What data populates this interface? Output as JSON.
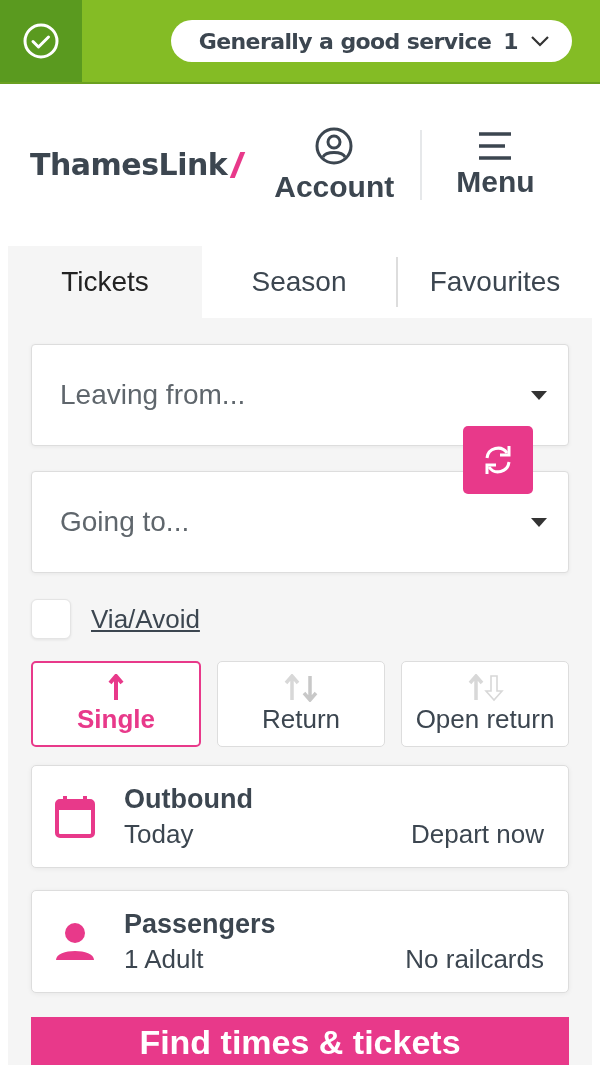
{
  "status_bar": {
    "message": "Generally a good service",
    "count": "1"
  },
  "header": {
    "logo": "ThamesLink",
    "account": "Account",
    "menu": "Menu"
  },
  "tabs": [
    {
      "label": "Tickets",
      "selected": true
    },
    {
      "label": "Season",
      "selected": false
    },
    {
      "label": "Favourites",
      "selected": false
    }
  ],
  "from_field": {
    "placeholder": "Leaving from..."
  },
  "to_field": {
    "placeholder": "Going to..."
  },
  "via": {
    "label": "Via/Avoid",
    "checked": false
  },
  "ticket_types": [
    {
      "label": "Single",
      "kind": "single",
      "selected": true
    },
    {
      "label": "Return",
      "kind": "return",
      "selected": false
    },
    {
      "label": "Open return",
      "kind": "open",
      "selected": false
    }
  ],
  "outbound": {
    "title": "Outbound",
    "date": "Today",
    "time": "Depart now"
  },
  "passengers": {
    "title": "Passengers",
    "count": "1 Adult",
    "railcards": "No railcards"
  },
  "submit": "Find times & tickets"
}
